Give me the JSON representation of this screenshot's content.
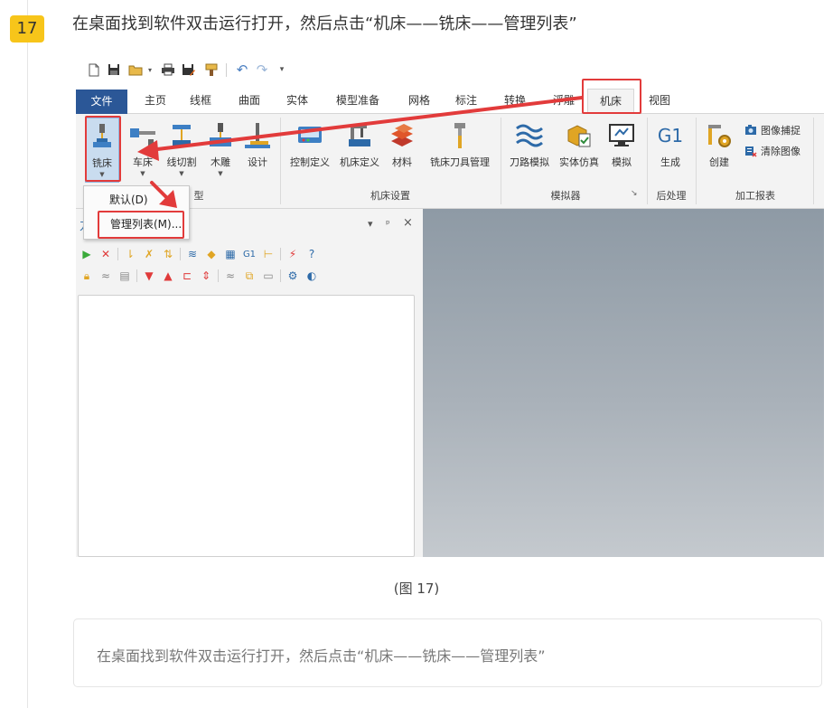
{
  "step": {
    "number": "17",
    "title": "在桌面找到软件双击运行打开，然后点击“机床——铣床——管理列表”"
  },
  "ribbon_tabs": [
    "文件",
    "主页",
    "线框",
    "曲面",
    "实体",
    "模型准备",
    "网格",
    "标注",
    "转换",
    "浮雕",
    "机床",
    "视图"
  ],
  "active_tab": "机床",
  "groups": {
    "machine_type": {
      "label": "型",
      "buttons": [
        "铣床",
        "车床",
        "线切割",
        "木雕",
        "设计"
      ]
    },
    "machine_setup": {
      "label": "机床设置",
      "buttons": [
        "控制定义",
        "机床定义",
        "材料",
        "铣床刀具管理"
      ]
    },
    "simulator": {
      "label": "模拟器",
      "buttons": [
        "刀路模拟",
        "实体仿真",
        "模拟"
      ]
    },
    "post": {
      "label": "后处理",
      "buttons": [
        "生成"
      ],
      "g1_glyph": "G1"
    },
    "report": {
      "label": "加工报表",
      "buttons": [
        "创建"
      ],
      "small_buttons": [
        "图像捕捉",
        "清除图像"
      ]
    }
  },
  "dropdown": {
    "items": [
      "默认(D)",
      "管理列表(M)..."
    ]
  },
  "panel": {
    "letter": "刀",
    "pin": "ᵖ",
    "close": "×",
    "menu_arrow": "▾",
    "g1_tool": "G1"
  },
  "caption": "(图 17)",
  "textbox": "在桌面找到软件双击运行打开，然后点击“机床——铣床——管理列表”",
  "colors": {
    "badge": "#f7c51a",
    "file_tab": "#2b5797",
    "highlight": "#e23b3b"
  }
}
